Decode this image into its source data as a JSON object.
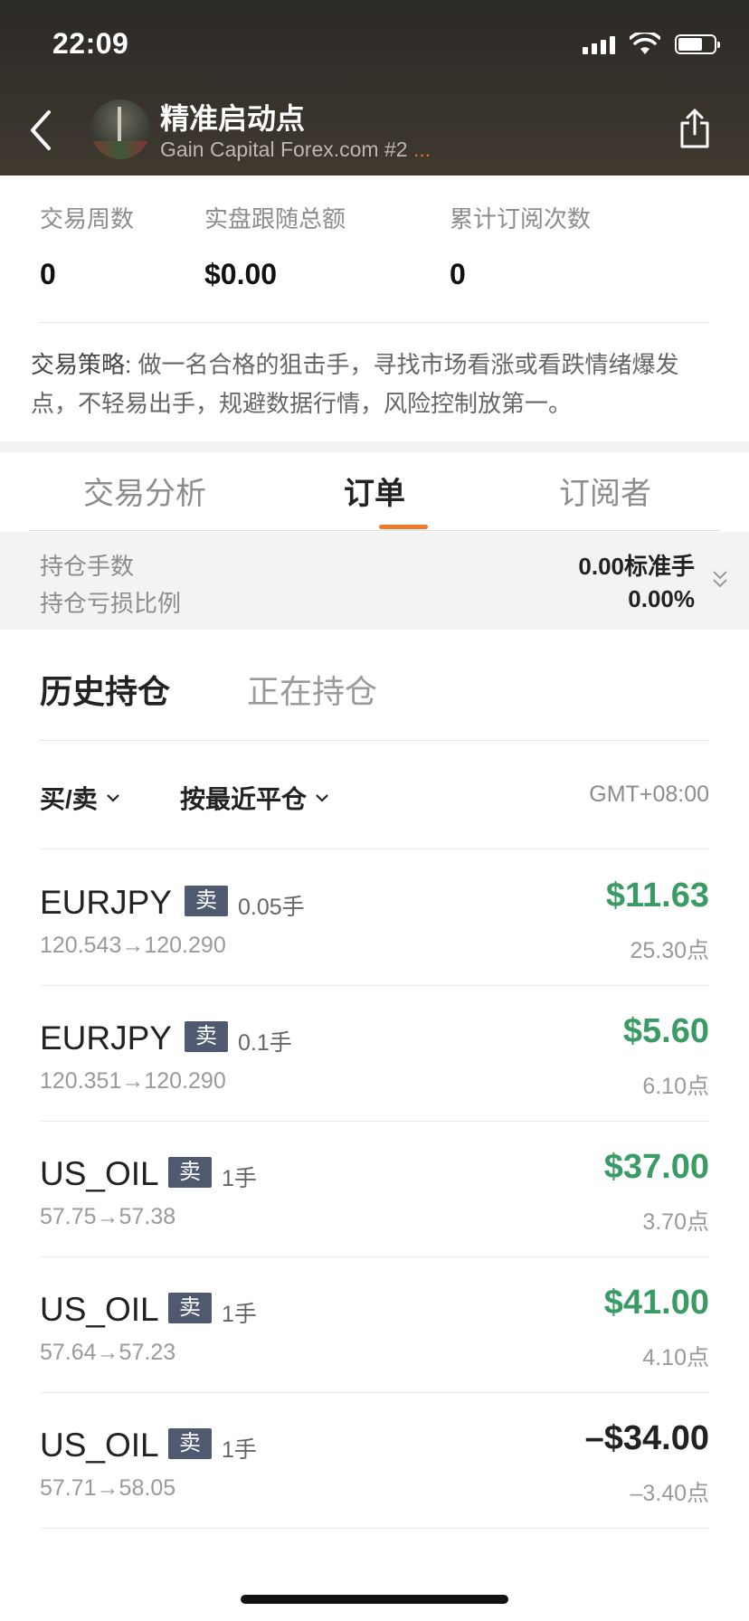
{
  "status_bar": {
    "time": "22:09"
  },
  "header": {
    "title": "精准启动点",
    "subtitle": "Gain Capital Forex.com #2",
    "subtitle_ellipsis": "...",
    "icons": [
      "back-arrow-icon",
      "avatar-image",
      "share-icon"
    ]
  },
  "stats": [
    {
      "label": "交易周数",
      "value": "0"
    },
    {
      "label": "实盘跟随总额",
      "value": "$0.00"
    },
    {
      "label": "累计订阅次数",
      "value": "0"
    }
  ],
  "strategy": {
    "label": "交易策略:",
    "text": " 做一名合格的狙击手，寻找市场看涨或看跌情绪爆发点，不轻易出手，规避数据行情，风险控制放第一。"
  },
  "tabs": [
    {
      "label": "交易分析",
      "active": false
    },
    {
      "label": "订单",
      "active": true
    },
    {
      "label": "订阅者",
      "active": false
    }
  ],
  "summary": {
    "lots_label": "持仓手数",
    "lots_value": "0.00标准手",
    "ratio_label": "持仓亏损比例",
    "ratio_value": "0.00%"
  },
  "subtabs": [
    {
      "label": "历史持仓",
      "active": true
    },
    {
      "label": "正在持仓",
      "active": false
    }
  ],
  "filters": {
    "side": "买/卖",
    "sort": "按最近平仓",
    "timezone": "GMT+08:00"
  },
  "orders": [
    {
      "symbol": "EURJPY",
      "side": "卖",
      "lots": "0.05手",
      "prices": "120.543→120.290",
      "pnl": "$11.63",
      "points": "25.30点",
      "positive": true
    },
    {
      "symbol": "EURJPY",
      "side": "卖",
      "lots": "0.1手",
      "prices": "120.351→120.290",
      "pnl": "$5.60",
      "points": "6.10点",
      "positive": true
    },
    {
      "symbol": "US_OIL",
      "side": "卖",
      "lots": "1手",
      "prices": "57.75→57.38",
      "pnl": "$37.00",
      "points": "3.70点",
      "positive": true
    },
    {
      "symbol": "US_OIL",
      "side": "卖",
      "lots": "1手",
      "prices": "57.64→57.23",
      "pnl": "$41.00",
      "points": "4.10点",
      "positive": true
    },
    {
      "symbol": "US_OIL",
      "side": "卖",
      "lots": "1手",
      "prices": "57.71→58.05",
      "pnl": "–$34.00",
      "points": "–3.40点",
      "positive": false
    }
  ],
  "colors": {
    "accent": "#f07a2a",
    "profit": "#3a9b64",
    "badge": "#4f5a70"
  }
}
